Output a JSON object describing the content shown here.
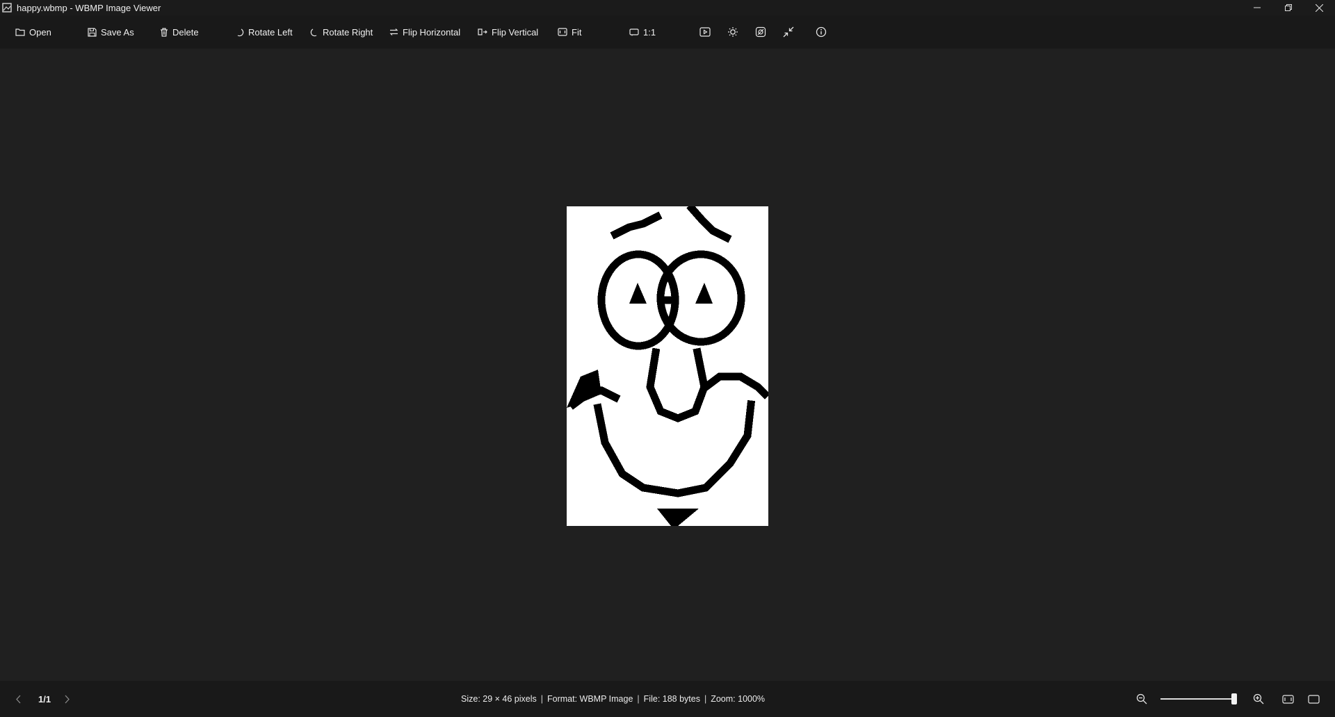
{
  "window": {
    "title": "happy.wbmp - WBMP Image Viewer"
  },
  "toolbar": {
    "open": "Open",
    "save_as": "Save As",
    "delete": "Delete",
    "rotate_left": "Rotate Left",
    "rotate_right": "Rotate Right",
    "flip_horizontal": "Flip Horizontal",
    "flip_vertical": "Flip Vertical",
    "fit": "Fit",
    "actual_size": "1:1",
    "icons": [
      "folder-icon",
      "save-icon",
      "trash-icon",
      "rotate-left-icon",
      "rotate-right-icon",
      "flip-horizontal-icon",
      "flip-vertical-icon",
      "fit-icon",
      "actual-size-icon",
      "slideshow-icon",
      "brightness-icon",
      "edit-image-icon",
      "exit-fullscreen-icon",
      "info-icon"
    ]
  },
  "status": {
    "page": "1/1",
    "size": "Size: 29 × 46 pixels",
    "format": "Format: WBMP Image",
    "file": "File: 188 bytes",
    "zoom": "Zoom: 1000%",
    "separator": "|",
    "zoom_slider_fraction": 1.0
  },
  "colors": {
    "background": "#202020",
    "toolbar": "#191919",
    "image_background": "#ffffff",
    "image_ink": "#000000"
  }
}
